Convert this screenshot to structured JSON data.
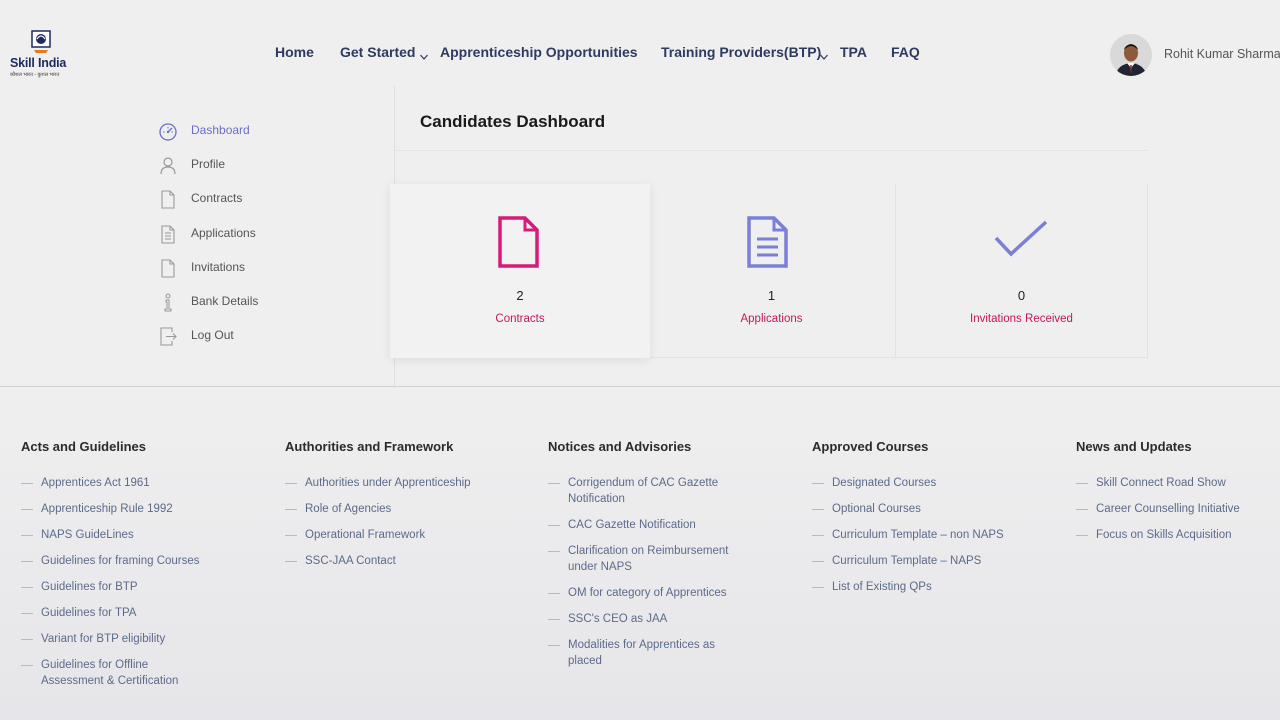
{
  "brand": {
    "name": "Skill India",
    "tagline": "कौशल भारत - कुशल भारत"
  },
  "nav": {
    "items": [
      {
        "label": "Home",
        "has_dropdown": false
      },
      {
        "label": "Get Started",
        "has_dropdown": true
      },
      {
        "label": "Apprenticeship Opportunities",
        "has_dropdown": false
      },
      {
        "label": "Training Providers(BTP)",
        "has_dropdown": true
      },
      {
        "label": "TPA",
        "has_dropdown": false
      },
      {
        "label": "FAQ",
        "has_dropdown": false
      }
    ]
  },
  "user": {
    "name": "Rohit Kumar Sharma"
  },
  "sidebar": {
    "items": [
      {
        "label": "Dashboard",
        "icon": "speedometer-icon",
        "active": true
      },
      {
        "label": "Profile",
        "icon": "user-icon",
        "active": false
      },
      {
        "label": "Contracts",
        "icon": "document-icon",
        "active": false
      },
      {
        "label": "Applications",
        "icon": "document-lines-icon",
        "active": false
      },
      {
        "label": "Invitations",
        "icon": "document-icon",
        "active": false
      },
      {
        "label": "Bank Details",
        "icon": "info-icon",
        "active": false
      },
      {
        "label": "Log Out",
        "icon": "logout-icon",
        "active": false
      }
    ]
  },
  "main": {
    "title": "Candidates Dashboard",
    "cards": [
      {
        "count": "2",
        "label": "Contracts",
        "icon": "document-icon",
        "color": "#d81b7a"
      },
      {
        "count": "1",
        "label": "Applications",
        "icon": "document-lines-icon",
        "color": "#7b7fd6"
      },
      {
        "count": "0",
        "label": "Invitations Received",
        "icon": "check-icon",
        "color": "#7b7fd6"
      }
    ]
  },
  "colors": {
    "accent_pink": "#c2185b",
    "accent_purple": "#6a6fc9",
    "nav_text": "#2e3a5f"
  },
  "footer": {
    "columns": [
      {
        "heading": "Acts and Guidelines",
        "links": [
          "Apprentices Act 1961",
          "Apprenticeship Rule 1992",
          "NAPS GuideLines",
          "Guidelines for framing Courses",
          "Guidelines for BTP",
          "Guidelines for TPA",
          "Variant for BTP eligibility",
          "Guidelines for Offline Assessment & Certification"
        ]
      },
      {
        "heading": "Authorities and Framework",
        "links": [
          "Authorities under Apprenticeship",
          "Role of Agencies",
          "Operational Framework",
          "SSC-JAA Contact"
        ]
      },
      {
        "heading": "Notices and Advisories",
        "links": [
          "Corrigendum of CAC Gazette Notification",
          "CAC Gazette Notification",
          "Clarification on Reimbursement under NAPS",
          "OM for category of Apprentices",
          "SSC's CEO as JAA",
          "Modalities for Apprentices as placed"
        ]
      },
      {
        "heading": "Approved Courses",
        "links": [
          "Designated Courses",
          "Optional Courses",
          "Curriculum Template – non NAPS",
          "Curriculum Template – NAPS",
          "List of Existing QPs"
        ]
      },
      {
        "heading": "News and Updates",
        "links": [
          "Skill Connect Road Show",
          "Career Counselling Initiative",
          "Focus on Skills Acquisition"
        ]
      }
    ]
  }
}
